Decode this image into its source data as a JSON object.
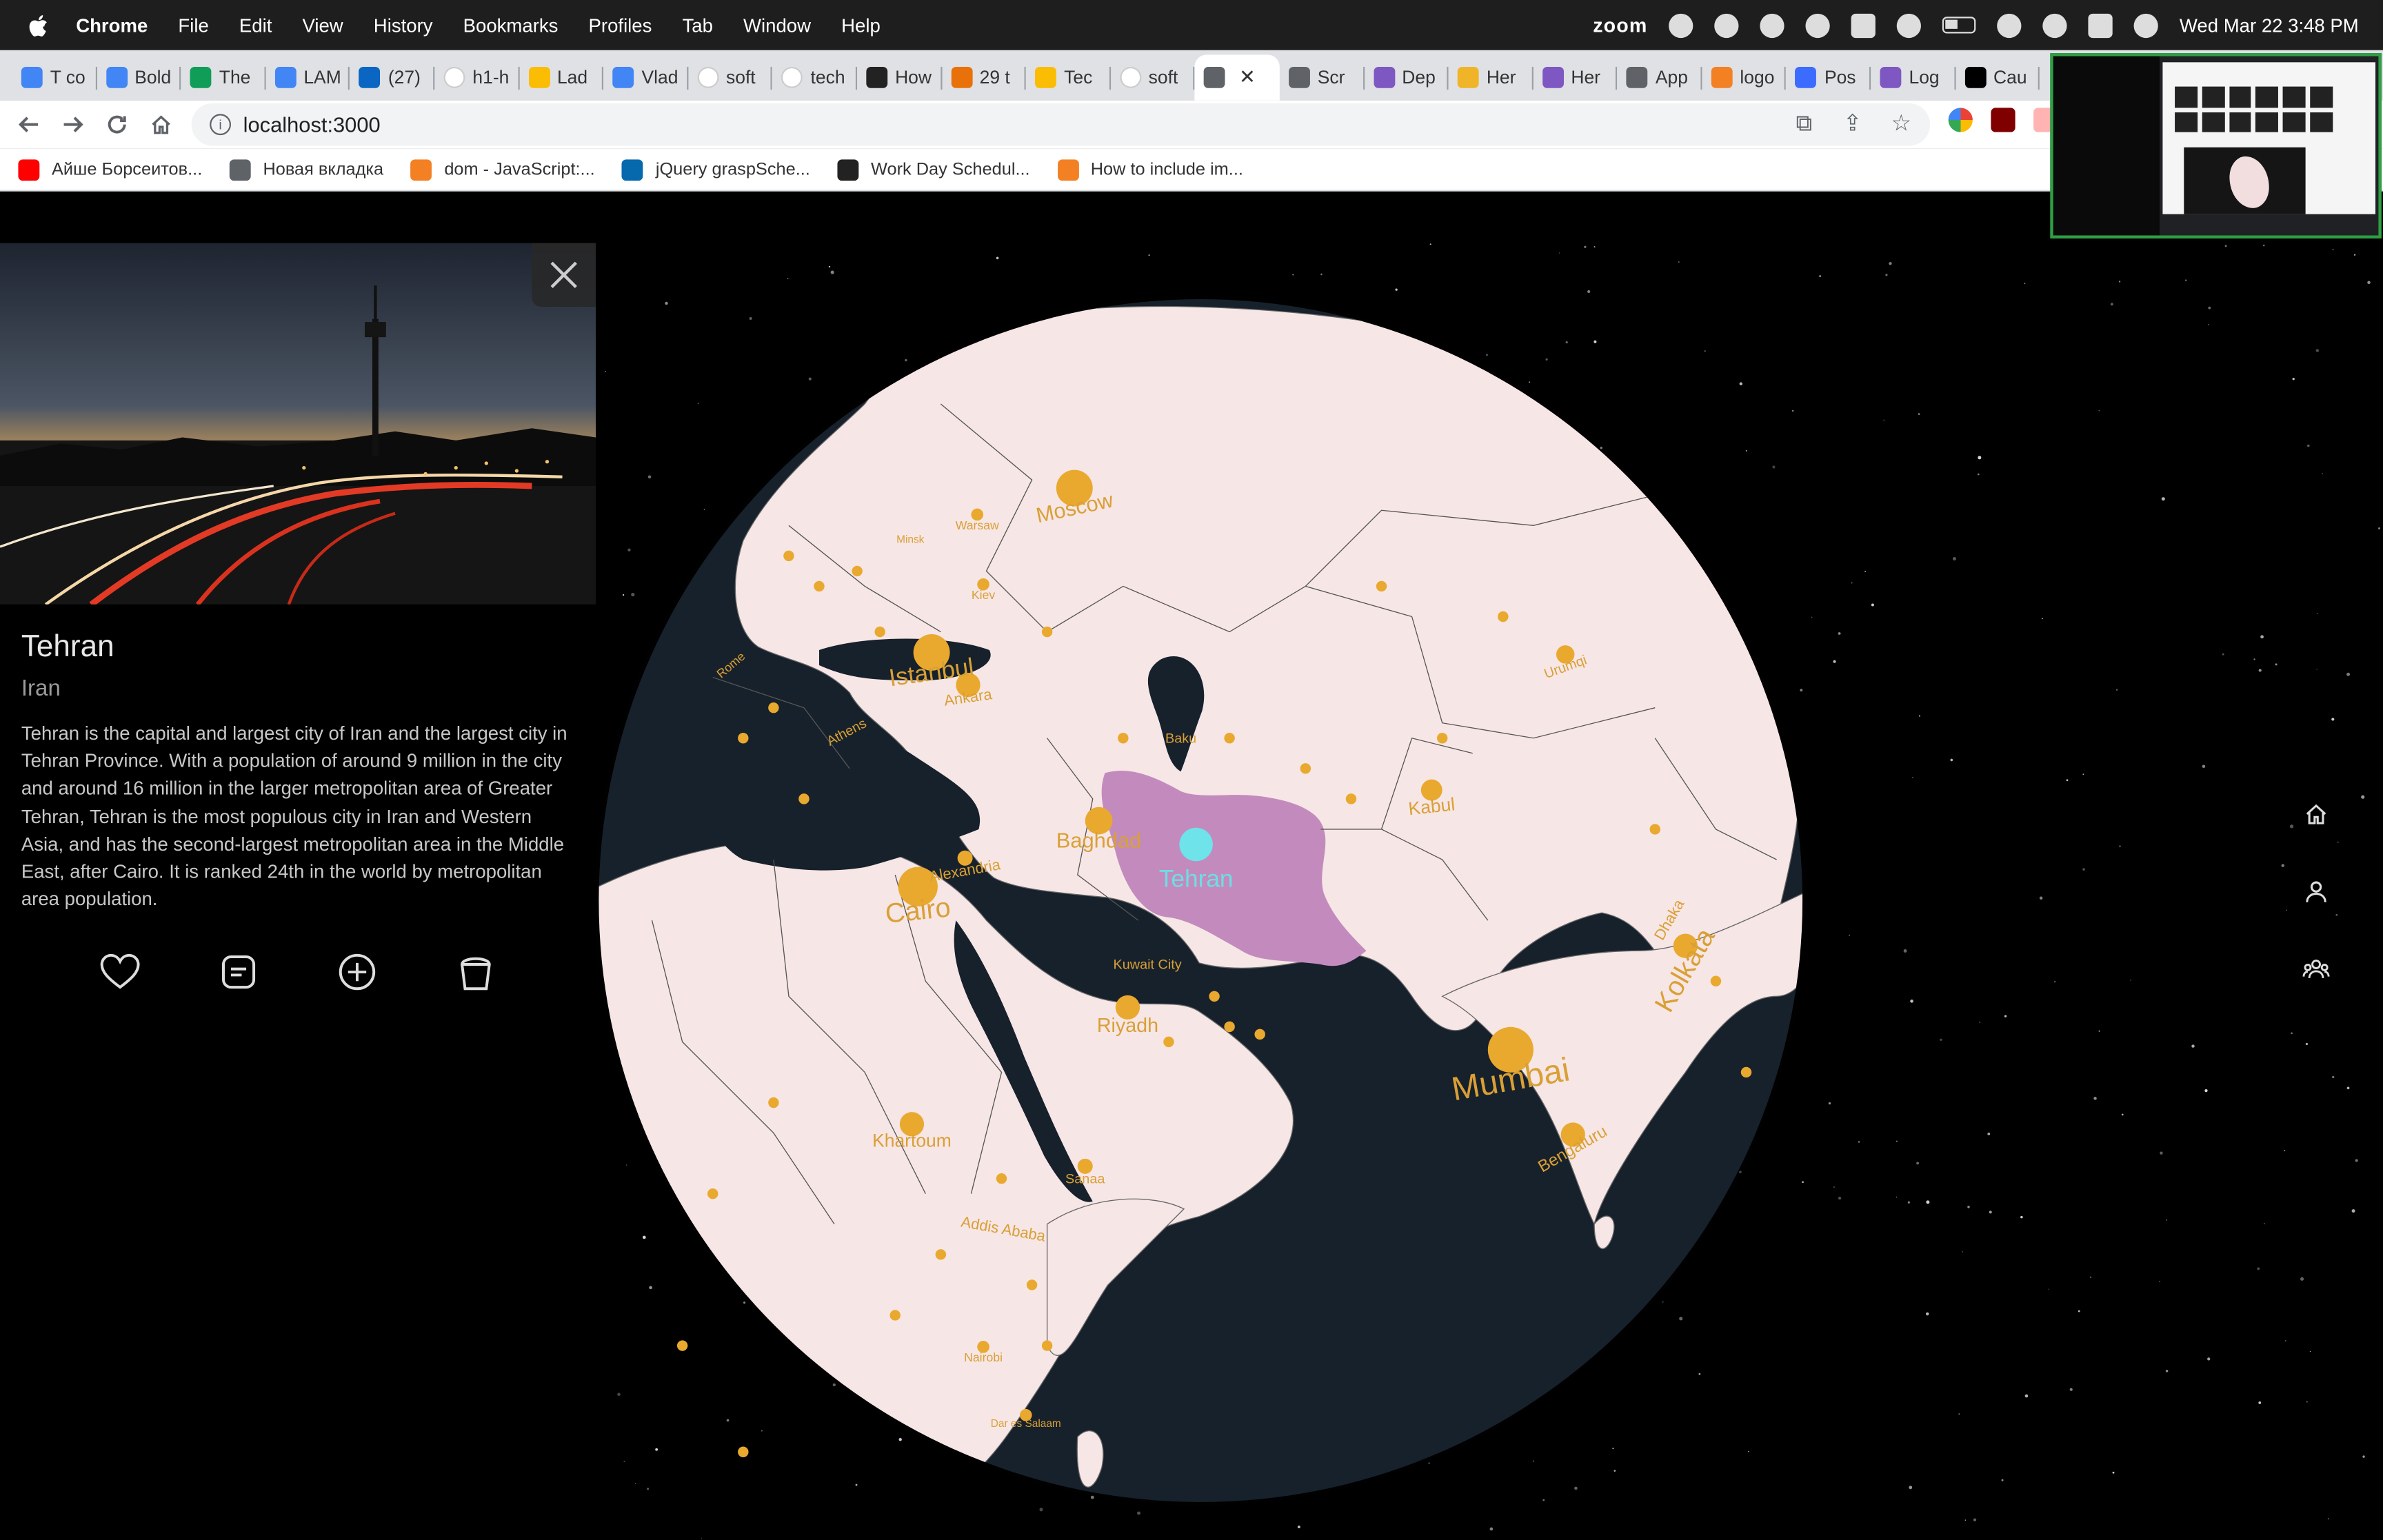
{
  "menubar": {
    "app_name": "Chrome",
    "items": [
      "File",
      "Edit",
      "View",
      "History",
      "Bookmarks",
      "Profiles",
      "Tab",
      "Window",
      "Help"
    ],
    "zoom_label": "zoom",
    "clock": "Wed Mar 22  3:48 PM"
  },
  "tabs": [
    {
      "label": "T co",
      "icon": "google-docs-icon",
      "color": "#4285f4"
    },
    {
      "label": "Bold",
      "icon": "google-docs-icon",
      "color": "#4285f4"
    },
    {
      "label": "The",
      "icon": "google-sheets-icon",
      "color": "#0f9d58"
    },
    {
      "label": "LAM",
      "icon": "google-docs-icon",
      "color": "#4285f4"
    },
    {
      "label": "(27)",
      "icon": "linkedin-icon",
      "color": "#0a66c2"
    },
    {
      "label": "h1-h",
      "icon": "google-icon",
      "color": "#ffffff"
    },
    {
      "label": "Lad",
      "icon": "google-drive-icon",
      "color": "#fbbc04"
    },
    {
      "label": "Vlad",
      "icon": "google-docs-icon",
      "color": "#4285f4"
    },
    {
      "label": "soft",
      "icon": "google-icon",
      "color": "#ffffff"
    },
    {
      "label": "tech",
      "icon": "google-icon",
      "color": "#ffffff"
    },
    {
      "label": "How",
      "icon": "hashnode-icon",
      "color": "#222222"
    },
    {
      "label": "29 t",
      "icon": "check-circle-icon",
      "color": "#e8710a"
    },
    {
      "label": "Tec",
      "icon": "google-drive-icon",
      "color": "#fbbc04"
    },
    {
      "label": "soft",
      "icon": "google-icon",
      "color": "#ffffff"
    },
    {
      "label": "",
      "icon": "globe-icon",
      "color": "#5f6368",
      "active": true
    },
    {
      "label": "Scr",
      "icon": "globe-icon",
      "color": "#5f6368"
    },
    {
      "label": "Dep",
      "icon": "heroku-icon",
      "color": "#7e57c2"
    },
    {
      "label": "Her",
      "icon": "fs-icon",
      "color": "#f0b429"
    },
    {
      "label": "Her",
      "icon": "heroku-icon",
      "color": "#7e57c2"
    },
    {
      "label": "App",
      "icon": "globe-icon",
      "color": "#5f6368"
    },
    {
      "label": "logo",
      "icon": "stackoverflow-icon",
      "color": "#f48024"
    },
    {
      "label": "Pos",
      "icon": "zulip-icon",
      "color": "#3b6bff"
    },
    {
      "label": "Log",
      "icon": "heroku-icon",
      "color": "#7e57c2"
    },
    {
      "label": "Cau",
      "icon": "dev-icon",
      "color": "#000000"
    }
  ],
  "address_bar": {
    "url": "localhost:3000"
  },
  "bookmarks": [
    {
      "label": "Айше Борсеитов...",
      "icon": "youtube-icon",
      "color": "#ff0000"
    },
    {
      "label": "Новая вкладка",
      "icon": "globe-icon",
      "color": "#5f6368"
    },
    {
      "label": "dom - JavaScript:...",
      "icon": "stackoverflow-icon",
      "color": "#f48024"
    },
    {
      "label": "jQuery graspSche...",
      "icon": "jquery-icon",
      "color": "#0769ad"
    },
    {
      "label": "Work Day Schedul...",
      "icon": "github-icon",
      "color": "#222222"
    },
    {
      "label": "How to include im...",
      "icon": "stackoverflow-icon",
      "color": "#f48024"
    }
  ],
  "panel": {
    "city": "Tehran",
    "country": "Iran",
    "description": "Tehran is the capital and largest city of Iran and the largest city in Tehran Province. With a population of around 9 million in the city and around 16 million in the larger metropolitan area of Greater Tehran, Tehran is the most populous city in Iran and Western Asia, and has the second-largest metropolitan area in the Middle East, after Cairo. It is ranked 24th in the world by metropolitan area population.",
    "actions": [
      "heart-icon",
      "notes-icon",
      "add-circle-icon",
      "bucket-icon"
    ]
  },
  "globe": {
    "land_color": "#f7e6e6",
    "ocean_color": "#17212b",
    "highlight_color": "#c38bbd",
    "marker_color": "#e9a92e",
    "selected_color": "#6fe3ea",
    "selected_city": "Tehran",
    "city_labels": [
      "Moscow",
      "Istanbul",
      "Ankara",
      "Athens",
      "Rome",
      "Cairo",
      "Alexandria",
      "Baghdad",
      "Baku",
      "Kuwait City",
      "Riyadh",
      "Kabul",
      "Mumbai",
      "Bengaluru",
      "Kolkata",
      "Dhaka",
      "Khartoum",
      "Sanaa",
      "Addis Ababa",
      "Nairobi",
      "Dar es Salaam",
      "Urumqi",
      "Kiev",
      "Minsk",
      "Warsaw"
    ]
  },
  "side_nav": [
    "home-icon",
    "user-icon",
    "group-icon"
  ]
}
